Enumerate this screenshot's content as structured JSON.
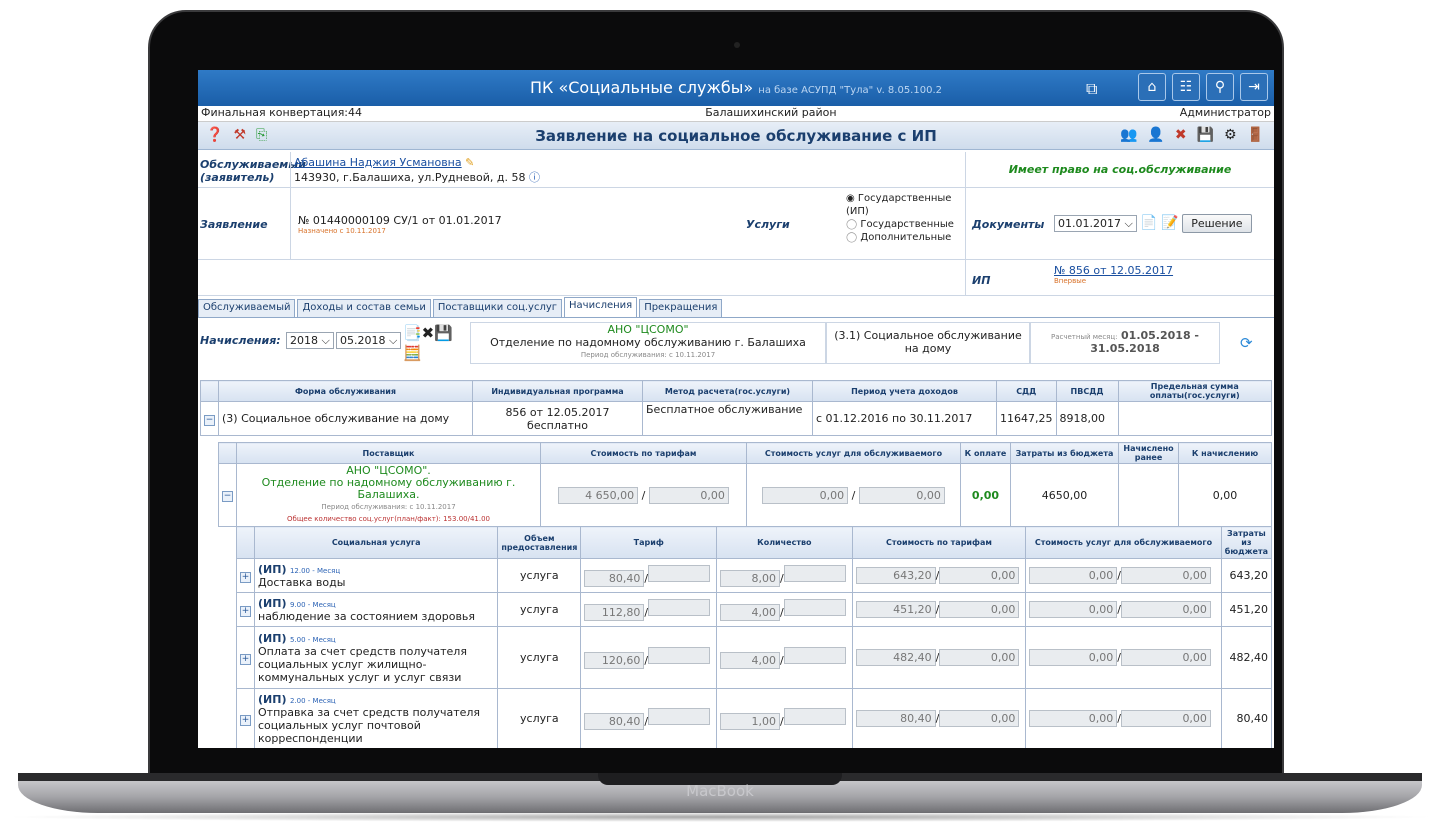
{
  "app": {
    "title": "ПК «Социальные службы»",
    "subtitle": "на базе АСУПД \"Тула\"  v. 8.05.100.2",
    "nav_icons": [
      "главная",
      "регистр",
      "поиск",
      "выход"
    ]
  },
  "status": {
    "left": "Финальная конвертация:44",
    "center": "Балашихинский район",
    "right": "Администратор"
  },
  "page": {
    "title": "Заявление на социальное обслуживание с ИП"
  },
  "client": {
    "label1": "Обслуживаемый",
    "label2": "(заявитель)",
    "name": "Абашина Наджия Усмановна",
    "address": "143930, г.Балашиха, ул.Рудневой, д. 58",
    "right_text": "Имеет право на соц.обслуживание"
  },
  "application": {
    "label": "Заявление",
    "number": "№ 01440000109 СУ/1  от 01.01.2017",
    "note": "Назначено с 10.11.2017",
    "services_label": "Услуги",
    "radio": [
      "Государственные (ИП)",
      "Государственные",
      "Дополнительные"
    ],
    "documents_label": "Документы",
    "documents_date": "01.01.2017",
    "decision_btn": "Решение",
    "ip_label": "ИП",
    "ip_link": "№ 856 от 12.05.2017",
    "ip_note": "Впервые"
  },
  "tabs": [
    "Обслуживаемый",
    "Доходы и состав семьи",
    "Поставщики соц.услуг",
    "Начисления",
    "Прекращения"
  ],
  "accruals": {
    "label": "Начисления:",
    "year": "2018",
    "month": "05.2018",
    "provider1": "АНО \"ЦСОМО\"",
    "provider2": "Отделение по надомному обслуживанию г. Балашиха",
    "provider_note": "Период обслуживания: с 10.11.2017",
    "service": "(3.1) Социальное обслуживание на дому",
    "calc_label": "Расчетный месяц:",
    "calc_period1": "01.05.2018 -",
    "calc_period2": "31.05.2018"
  },
  "form_table": {
    "headers": [
      "Форма обслуживания",
      "Индивидуальная программа",
      "Метод расчета(гос.услуги)",
      "Период учета доходов",
      "СДД",
      "ПВСДД",
      "Предельная сумма оплаты(гос.услуги)"
    ],
    "row": {
      "form": "(3) Социальное обслуживание на дому",
      "program1": "856 от 12.05.2017",
      "program2": "бесплатно",
      "method": "Бесплатное обслуживание",
      "period": "с 01.12.2016 по 30.11.2017",
      "sdd": "11647,25",
      "pvsdd": "8918,00",
      "limit": ""
    }
  },
  "provider_table": {
    "headers": [
      "Поставщик",
      "Стоимость по тарифам",
      "Стоимость услуг для обслуживаемого",
      "К оплате",
      "Затраты из бюджета",
      "Начислено ранее",
      "К начислению"
    ],
    "name1": "АНО \"ЦСОМО\".",
    "name2": "Отделение по надомному обслуживанию г. Балашиха.",
    "note1": "Период обслуживания: с 10.11.2017",
    "note2": "Общее количество соц.услуг(план/факт): 153.00/41.00",
    "tariff_a": "4 650,00",
    "tariff_b": "0,00",
    "client_a": "0,00",
    "client_b": "0,00",
    "to_pay": "0,00",
    "budget": "4650,00",
    "earlier": "",
    "to_accrue": "0,00"
  },
  "services_table": {
    "headers": [
      "Социальная услуга",
      "Объем предоставления",
      "Тариф",
      "Количество",
      "Стоимость по тарифам",
      "Стоимость услуг для обслуживаемого",
      "Затраты из бюджета"
    ],
    "rows": [
      {
        "tag": "(ИП)",
        "plan": "12.00 - Месяц",
        "name": "Доставка воды",
        "unit": "услуга",
        "tariff": "80,40",
        "qty": "8,00",
        "cost": "643,20",
        "c2": "0,00",
        "c3": "0,00",
        "c4": "0,00",
        "budget": "643,20"
      },
      {
        "tag": "(ИП)",
        "plan": "9.00 - Месяц",
        "name": "наблюдение за состоянием здоровья",
        "unit": "услуга",
        "tariff": "112,80",
        "qty": "4,00",
        "cost": "451,20",
        "c2": "0,00",
        "c3": "0,00",
        "c4": "0,00",
        "budget": "451,20"
      },
      {
        "tag": "(ИП)",
        "plan": "5.00 - Месяц",
        "name": "Оплата за счет средств получателя социальных услуг жилищно-коммунальных услуг и услуг связи",
        "unit": "услуга",
        "tariff": "120,60",
        "qty": "4,00",
        "cost": "482,40",
        "c2": "0,00",
        "c3": "0,00",
        "c4": "0,00",
        "budget": "482,40"
      },
      {
        "tag": "(ИП)",
        "plan": "2.00 - Месяц",
        "name": "Отправка за счет средств получателя социальных услуг почтовой корреспонденции",
        "unit": "услуга",
        "tariff": "80,40",
        "qty": "1,00",
        "cost": "80,40",
        "c2": "0,00",
        "c3": "0,00",
        "c4": "0,00",
        "budget": "80,40"
      }
    ]
  },
  "device": {
    "brand": "MacBook"
  }
}
